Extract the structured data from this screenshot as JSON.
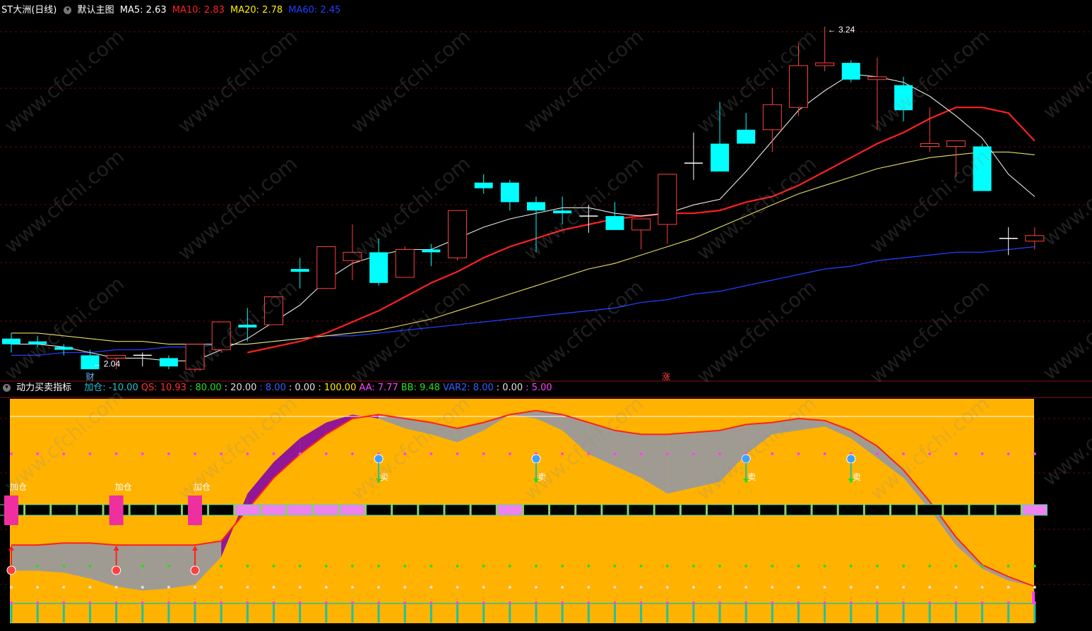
{
  "main_header": {
    "title": "ST大洲(日线)",
    "template": "默认主图",
    "ma5": "MA5: 2.63",
    "ma10": "MA10: 2.83",
    "ma20": "MA20: 2.78",
    "ma60": "MA60: 2.45"
  },
  "sub_header": {
    "title": "动力买卖指标",
    "items": [
      {
        "text": "加仓: -10.00",
        "color": "#22c0d0"
      },
      {
        "text": "QS: 10.93",
        "color": "#ff3030"
      },
      {
        "text": ": 80.00",
        "color": "#20e020"
      },
      {
        "text": ": 20.00",
        "color": "#e0e0e0"
      },
      {
        "text": ": 8.00",
        "color": "#3060ff"
      },
      {
        "text": ": 0.00",
        "color": "#e0e0e0"
      },
      {
        "text": ": 100.00",
        "color": "#ffee00"
      },
      {
        "text": "AA: 7.77",
        "color": "#ff40ff"
      },
      {
        "text": "BB: 9.48",
        "color": "#20e020"
      },
      {
        "text": "VAR2: 8.00",
        "color": "#3060ff"
      },
      {
        "text": ": 0.00",
        "color": "#e0e0e0"
      },
      {
        "text": ": 5.00",
        "color": "#ff40ff"
      }
    ]
  },
  "annotations": {
    "high_label": "3.24",
    "low_label": "2.04",
    "cai_label": "财",
    "zhang_label": "涨",
    "buy_label": "加仓",
    "sell_label": "卖"
  },
  "watermark": "www.cfchi.com",
  "chart_data": [
    {
      "type": "candlestick",
      "title": "ST大洲(日线)",
      "ylim": [
        1.98,
        3.28
      ],
      "high_marker": 3.24,
      "low_marker": 2.04,
      "candles": [
        {
          "o": 2.12,
          "h": 2.14,
          "l": 2.07,
          "c": 2.1
        },
        {
          "o": 2.11,
          "h": 2.13,
          "l": 2.09,
          "c": 2.1
        },
        {
          "o": 2.09,
          "h": 2.1,
          "l": 2.06,
          "c": 2.08
        },
        {
          "o": 2.06,
          "h": 2.08,
          "l": 2.04,
          "c": 2.01
        },
        {
          "o": 2.05,
          "h": 2.06,
          "l": 2.01,
          "c": 2.06
        },
        {
          "o": 2.06,
          "h": 2.07,
          "l": 2.02,
          "c": 2.06
        },
        {
          "o": 2.05,
          "h": 2.06,
          "l": 2.01,
          "c": 2.02
        },
        {
          "o": 2.01,
          "h": 2.1,
          "l": 2.0,
          "c": 2.1
        },
        {
          "o": 2.08,
          "h": 2.18,
          "l": 2.07,
          "c": 2.18
        },
        {
          "o": 2.17,
          "h": 2.23,
          "l": 2.11,
          "c": 2.16
        },
        {
          "o": 2.17,
          "h": 2.27,
          "l": 2.17,
          "c": 2.27
        },
        {
          "o": 2.37,
          "h": 2.41,
          "l": 2.3,
          "c": 2.36
        },
        {
          "o": 2.3,
          "h": 2.45,
          "l": 2.3,
          "c": 2.45
        },
        {
          "o": 2.4,
          "h": 2.53,
          "l": 2.33,
          "c": 2.43
        },
        {
          "o": 2.43,
          "h": 2.48,
          "l": 2.31,
          "c": 2.32
        },
        {
          "o": 2.34,
          "h": 2.45,
          "l": 2.34,
          "c": 2.44
        },
        {
          "o": 2.44,
          "h": 2.46,
          "l": 2.38,
          "c": 2.43
        },
        {
          "o": 2.41,
          "h": 2.58,
          "l": 2.4,
          "c": 2.58
        },
        {
          "o": 2.68,
          "h": 2.71,
          "l": 2.64,
          "c": 2.66
        },
        {
          "o": 2.68,
          "h": 2.69,
          "l": 2.58,
          "c": 2.61
        },
        {
          "o": 2.61,
          "h": 2.63,
          "l": 2.43,
          "c": 2.58
        },
        {
          "o": 2.58,
          "h": 2.63,
          "l": 2.53,
          "c": 2.57
        },
        {
          "o": 2.56,
          "h": 2.6,
          "l": 2.5,
          "c": 2.56
        },
        {
          "o": 2.56,
          "h": 2.61,
          "l": 2.51,
          "c": 2.51
        },
        {
          "o": 2.51,
          "h": 2.55,
          "l": 2.44,
          "c": 2.55
        },
        {
          "o": 2.53,
          "h": 2.56,
          "l": 2.46,
          "c": 2.71
        },
        {
          "o": 2.75,
          "h": 2.86,
          "l": 2.69,
          "c": 2.75
        },
        {
          "o": 2.82,
          "h": 2.97,
          "l": 2.76,
          "c": 2.72
        },
        {
          "o": 2.87,
          "h": 2.93,
          "l": 2.82,
          "c": 2.82
        },
        {
          "o": 2.87,
          "h": 3.02,
          "l": 2.79,
          "c": 2.96
        },
        {
          "o": 2.95,
          "h": 3.18,
          "l": 2.92,
          "c": 3.1
        },
        {
          "o": 3.1,
          "h": 3.24,
          "l": 3.08,
          "c": 3.11
        },
        {
          "o": 3.11,
          "h": 3.12,
          "l": 3.04,
          "c": 3.05
        },
        {
          "o": 3.05,
          "h": 3.13,
          "l": 2.87,
          "c": 3.06
        },
        {
          "o": 3.03,
          "h": 3.06,
          "l": 2.9,
          "c": 2.94
        },
        {
          "o": 2.81,
          "h": 2.95,
          "l": 2.79,
          "c": 2.82
        },
        {
          "o": 2.81,
          "h": 2.83,
          "l": 2.7,
          "c": 2.83
        },
        {
          "o": 2.81,
          "h": 2.82,
          "l": 2.68,
          "c": 2.65
        },
        {
          "o": 2.48,
          "h": 2.52,
          "l": 2.42,
          "c": 2.48
        },
        {
          "o": 2.47,
          "h": 2.52,
          "l": 2.44,
          "c": 2.49
        }
      ],
      "ma5": [
        2.1,
        2.1,
        2.09,
        2.07,
        2.05,
        2.05,
        2.04,
        2.04,
        2.08,
        2.12,
        2.18,
        2.24,
        2.33,
        2.39,
        2.42,
        2.44,
        2.44,
        2.48,
        2.52,
        2.55,
        2.57,
        2.59,
        2.59,
        2.57,
        2.56,
        2.57,
        2.6,
        2.62,
        2.72,
        2.83,
        2.94,
        3.01,
        3.07,
        3.06,
        3.04,
        2.99,
        2.92,
        2.84,
        2.71,
        2.63
      ],
      "ma10": [
        null,
        null,
        null,
        null,
        null,
        null,
        null,
        null,
        null,
        2.07,
        2.09,
        2.11,
        2.14,
        2.18,
        2.22,
        2.27,
        2.32,
        2.36,
        2.41,
        2.45,
        2.48,
        2.51,
        2.53,
        2.55,
        2.56,
        2.57,
        2.57,
        2.58,
        2.61,
        2.63,
        2.67,
        2.72,
        2.77,
        2.82,
        2.86,
        2.91,
        2.95,
        2.95,
        2.93,
        2.83
      ],
      "ma20": [
        2.14,
        2.14,
        2.13,
        2.12,
        2.11,
        2.11,
        2.1,
        2.1,
        2.1,
        2.1,
        2.11,
        2.12,
        2.13,
        2.14,
        2.15,
        2.17,
        2.19,
        2.22,
        2.25,
        2.28,
        2.31,
        2.34,
        2.37,
        2.39,
        2.42,
        2.45,
        2.48,
        2.52,
        2.56,
        2.6,
        2.64,
        2.67,
        2.7,
        2.73,
        2.75,
        2.77,
        2.78,
        2.79,
        2.79,
        2.78
      ],
      "ma60": [
        2.06,
        2.06,
        2.07,
        2.07,
        2.08,
        2.08,
        2.09,
        2.09,
        2.1,
        2.1,
        2.11,
        2.12,
        2.13,
        2.13,
        2.14,
        2.15,
        2.16,
        2.17,
        2.18,
        2.19,
        2.2,
        2.21,
        2.22,
        2.23,
        2.25,
        2.26,
        2.28,
        2.29,
        2.31,
        2.33,
        2.35,
        2.37,
        2.38,
        2.4,
        2.41,
        2.42,
        2.43,
        2.43,
        2.44,
        2.45
      ],
      "colors": {
        "up": "#ff4040",
        "down": "#00ffff",
        "ma5": "#e8e8e8",
        "ma10": "#ff2020",
        "ma20": "#e8e060",
        "ma60": "#2040ff"
      }
    },
    {
      "type": "area",
      "title": "动力买卖指标",
      "ylim": [
        0,
        100
      ],
      "reference_levels": [
        100,
        80,
        50,
        20,
        0
      ],
      "qs": [
        13,
        13,
        12,
        9,
        5,
        3,
        4,
        6,
        20,
        52,
        68,
        80,
        88,
        92,
        90,
        85,
        82,
        78,
        84,
        92,
        90,
        84,
        72,
        66,
        60,
        52,
        55,
        58,
        72,
        82,
        84,
        86,
        80,
        70,
        60,
        44,
        26,
        14,
        8,
        5
      ],
      "trend": [
        26,
        26,
        27,
        27,
        26,
        26,
        26,
        26,
        28,
        44,
        60,
        72,
        82,
        90,
        92,
        90,
        88,
        85,
        88,
        92,
        94,
        92,
        88,
        84,
        82,
        82,
        83,
        84,
        87,
        88,
        90,
        89,
        84,
        76,
        64,
        48,
        30,
        16,
        10,
        5
      ],
      "buy_signals": [
        0,
        4,
        7
      ],
      "sell_signals": [
        14,
        20,
        28,
        32
      ],
      "colors": {
        "background": "#ffb300",
        "up_fill": "#8a0f9e",
        "down_fill": "#9a9a9a",
        "trend": "#ff2020",
        "bar_pink": "#ee82ee",
        "bar_black": "#000000",
        "bar_border": "#40e0b0"
      }
    }
  ]
}
